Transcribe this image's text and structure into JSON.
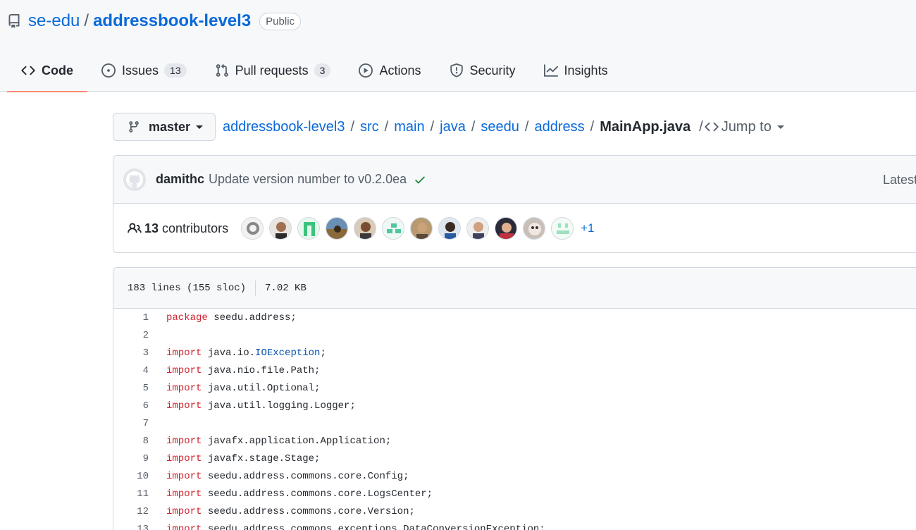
{
  "repo": {
    "owner": "se-edu",
    "separator": "/",
    "name": "addressbook-level3",
    "visibility": "Public"
  },
  "tabs": [
    {
      "label": "Code",
      "icon": "code-icon",
      "active": true
    },
    {
      "label": "Issues",
      "icon": "issue-opened-icon",
      "count": "13"
    },
    {
      "label": "Pull requests",
      "icon": "git-pull-request-icon",
      "count": "3"
    },
    {
      "label": "Actions",
      "icon": "play-icon"
    },
    {
      "label": "Security",
      "icon": "shield-icon"
    },
    {
      "label": "Insights",
      "icon": "graph-icon"
    }
  ],
  "breadcrumb": {
    "branch": "master",
    "parts": [
      "addressbook-level3",
      "src",
      "main",
      "java",
      "seedu",
      "address"
    ],
    "separator": "/",
    "file": "MainApp.java",
    "jump_label": "Jump to"
  },
  "commit": {
    "author": "damithc",
    "message": "Update version number to v0.2.0ea",
    "status": "success",
    "latest_label": "Latest"
  },
  "contributors": {
    "count": "13",
    "label": "contributors",
    "more": "+1",
    "avatars": [
      "avatar-1",
      "avatar-2",
      "avatar-3",
      "avatar-4",
      "avatar-5",
      "avatar-6",
      "avatar-7",
      "avatar-8",
      "avatar-9",
      "avatar-10",
      "avatar-11",
      "avatar-12"
    ]
  },
  "file_info": {
    "lines": "183 lines (155 sloc)",
    "size": "7.02 KB"
  },
  "code_lines": [
    {
      "n": "1",
      "parts": [
        {
          "t": "package",
          "c": "kw"
        },
        {
          "t": " seedu.address;"
        }
      ]
    },
    {
      "n": "2",
      "parts": []
    },
    {
      "n": "3",
      "parts": [
        {
          "t": "import",
          "c": "kw"
        },
        {
          "t": " java.io."
        },
        {
          "t": "IOException",
          "c": "ty"
        },
        {
          "t": ";"
        }
      ]
    },
    {
      "n": "4",
      "parts": [
        {
          "t": "import",
          "c": "kw"
        },
        {
          "t": " java.nio.file.Path;"
        }
      ]
    },
    {
      "n": "5",
      "parts": [
        {
          "t": "import",
          "c": "kw"
        },
        {
          "t": " java.util.Optional;"
        }
      ]
    },
    {
      "n": "6",
      "parts": [
        {
          "t": "import",
          "c": "kw"
        },
        {
          "t": " java.util.logging.Logger;"
        }
      ]
    },
    {
      "n": "7",
      "parts": []
    },
    {
      "n": "8",
      "parts": [
        {
          "t": "import",
          "c": "kw"
        },
        {
          "t": " javafx.application.Application;"
        }
      ]
    },
    {
      "n": "9",
      "parts": [
        {
          "t": "import",
          "c": "kw"
        },
        {
          "t": " javafx.stage.Stage;"
        }
      ]
    },
    {
      "n": "10",
      "parts": [
        {
          "t": "import",
          "c": "kw"
        },
        {
          "t": " seedu.address.commons.core.Config;"
        }
      ]
    },
    {
      "n": "11",
      "parts": [
        {
          "t": "import",
          "c": "kw"
        },
        {
          "t": " seedu.address.commons.core.LogsCenter;"
        }
      ]
    },
    {
      "n": "12",
      "parts": [
        {
          "t": "import",
          "c": "kw"
        },
        {
          "t": " seedu.address.commons.core.Version;"
        }
      ]
    },
    {
      "n": "13",
      "parts": [
        {
          "t": "import",
          "c": "kw"
        },
        {
          "t": " seedu.address.commons.exceptions.DataConversionException;"
        }
      ]
    }
  ],
  "colors": {
    "link": "#0969da",
    "keyword": "#cf222e",
    "type": "#0550ae",
    "active_tab_underline": "#fd8c73",
    "success": "#1a7f37"
  }
}
